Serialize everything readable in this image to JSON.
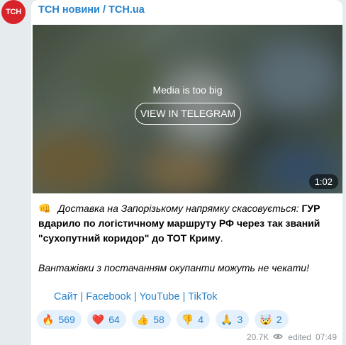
{
  "avatar": {
    "text": "ТСН",
    "color": "#d8232a"
  },
  "channel": {
    "name": "ТСН новини / TCH.ua"
  },
  "media": {
    "note": "Media is too big",
    "button": "VIEW IN TELEGRAM",
    "duration": "1:02"
  },
  "post": {
    "lead_emoji": "👊",
    "lead_italic": "Доставка на Запорізькому напрямку скасовується:",
    "body_1": "ГУР вдарило по логістичному маршруту РФ через так званий \"сухопутний коридор\" до ТОТ Криму",
    "body_1_end": ".",
    "body_2": "Вантажівки з постачанням окупанти можуть не чекати!"
  },
  "links": [
    {
      "label": "Сайт"
    },
    {
      "label": "Facebook"
    },
    {
      "label": "YouTube"
    },
    {
      "label": "TikTok"
    }
  ],
  "link_separator": "|",
  "reactions": [
    {
      "emoji": "🔥",
      "count": "569",
      "icon": "fire-icon"
    },
    {
      "emoji": "❤️",
      "count": "64",
      "icon": "heart-icon"
    },
    {
      "emoji": "👍",
      "count": "58",
      "icon": "thumbs-up-icon"
    },
    {
      "emoji": "👎",
      "count": "4",
      "icon": "thumbs-down-icon"
    },
    {
      "emoji": "🙏",
      "count": "3",
      "icon": "pray-icon"
    },
    {
      "emoji": "🤯",
      "count": "2",
      "icon": "mind-blown-icon"
    }
  ],
  "meta": {
    "views": "20.7K",
    "edited": "edited",
    "time": "07:49"
  },
  "colors": {
    "accent": "#2481cc",
    "reaction_bg": "#e4f0fb",
    "muted": "#8b9297"
  }
}
